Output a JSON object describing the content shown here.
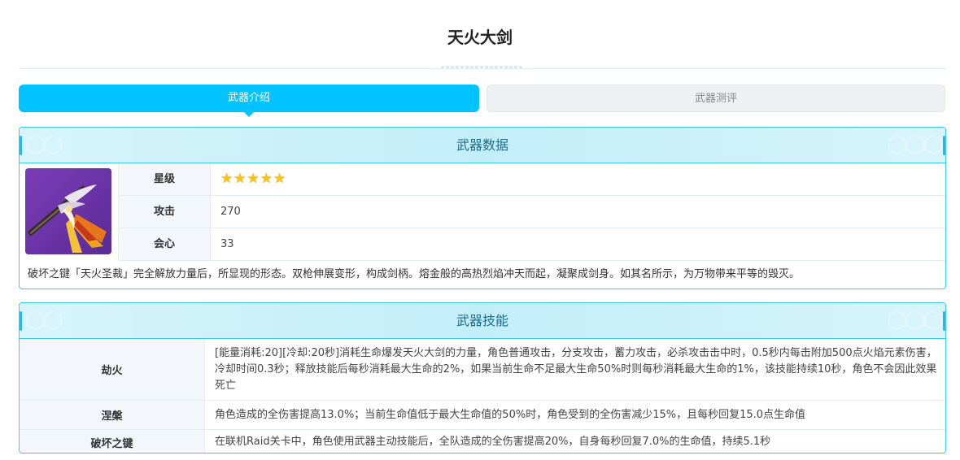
{
  "page": {
    "title": "天火大剑"
  },
  "tabs": [
    {
      "label": "武器介绍",
      "active": true
    },
    {
      "label": "武器测评",
      "active": false
    }
  ],
  "weapon_data": {
    "header": "武器数据",
    "image_icon": "sword-weapon-icon",
    "rows": {
      "star": {
        "label": "星级",
        "stars": 5
      },
      "attack": {
        "label": "攻击",
        "value": "270"
      },
      "crit": {
        "label": "会心",
        "value": "33"
      }
    },
    "description": "破坏之键「天火圣裁」完全解放力量后，所显现的形态。双枪伸展变形，构成剑柄。熔金般的高热烈焰冲天而起，凝聚成剑身。如其名所示，为万物带来平等的毁灭。"
  },
  "weapon_skills": {
    "header": "武器技能",
    "skills": [
      {
        "name": "劫火",
        "description": "[能量消耗:20][冷却:20秒]消耗生命爆发天火大剑的力量，角色普通攻击，分支攻击，蓄力攻击，必杀攻击击中时，0.5秒内每击附加500点火焰元素伤害，冷却时间0.3秒；释放技能后每秒消耗最大生命的2%，如果当前生命不足最大生命50%时则每秒消耗最大生命的1%，该技能持续10秒，角色不会因此效果死亡"
      },
      {
        "name": "涅槃",
        "description": "角色造成的全伤害提高13.0%；当前生命值低于最大生命值的50%时，角色受到的全伤害减少15%，且每秒回复15.0点生命值"
      },
      {
        "name": "破坏之键",
        "description": "在联机Raid关卡中，角色使用武器主动技能后，全队造成的全伤害提高20%，自身每秒回复7.0%的生命值，持续5.1秒"
      }
    ]
  },
  "colors": {
    "accent": "#00c3ff",
    "panel_border": "#3bc9ee",
    "header_text": "#1a6d8c",
    "star": "#f6c21c"
  }
}
